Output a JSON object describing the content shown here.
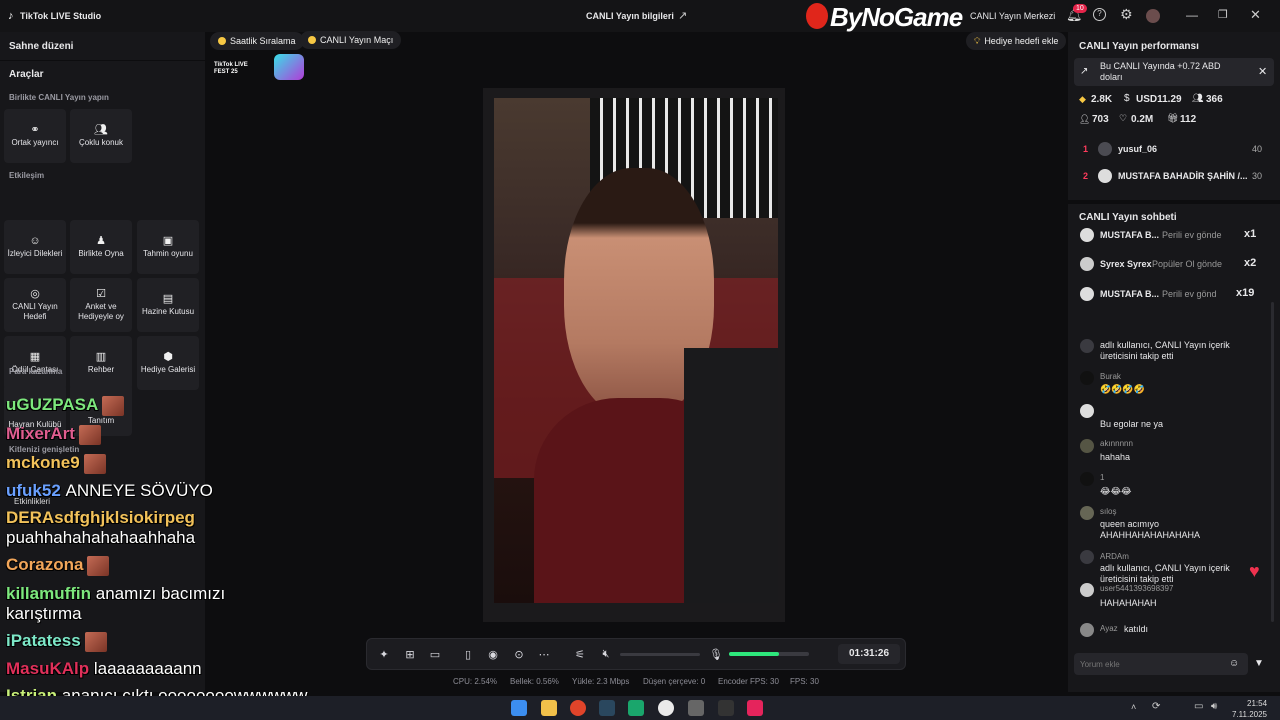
{
  "app": {
    "title": "TikTok LIVE Studio",
    "center_title": "CANLI Yayın bilgileri",
    "watermark": "ByNoGame",
    "live_center": "CANLI Yayın Merkezi",
    "notif_count": "10"
  },
  "left": {
    "scene": "Sahne düzeni",
    "tools": "Araçlar",
    "group1": "Birlikte CANLI Yayın yapın",
    "co_host": "Ortak yayıncı",
    "multi_guest": "Çoklu konuk",
    "group2": "Etkileşim",
    "viewer_wishes": "İzleyici Dilekleri",
    "play_together": "Birlikte Oyna",
    "prediction": "Tahmin oyunu",
    "live_goal": "CANLI Yayın Hedefi",
    "poll_gift": "Anket ve Hediyeyle oy",
    "treasure": "Hazine Kutusu",
    "reward_bag": "Ödül Çantası",
    "guide": "Rehber",
    "gift_gallery": "Hediye Galerisi",
    "group3": "Para kazanma",
    "fan_club": "Hayran Kulübü",
    "promotion": "Tanıtım",
    "kit": "Kitlenizi genişletin",
    "events": "Etkinlikleri"
  },
  "top_chips": {
    "hourly": "Saatlik Sıralama",
    "match": "CANLI Yayın Maçı",
    "gift_goal": "Hediye hedefi ekle",
    "fest": "TikTok LIVE FEST 25"
  },
  "overlay_chat": [
    {
      "user": "uGUZPASA",
      "msg": "",
      "color": "#7de87d",
      "emote": true
    },
    {
      "user": "MixerArt",
      "msg": "",
      "color": "#e05d8f",
      "emote": true
    },
    {
      "user": "mckone9",
      "msg": "",
      "color": "#f2c25a",
      "emote": true
    },
    {
      "user": "ufuk52",
      "msg": "ANNEYE SÖVÜYO",
      "color": "#6aa0ff",
      "emote": false
    },
    {
      "user": "DERAsdfghjklsiokirpeg",
      "msg": "",
      "color": "#f2c25a",
      "emote": false
    },
    {
      "user": "",
      "msg": "puahhahahahahaahhaha",
      "color": "#ffffff",
      "emote": false
    },
    {
      "user": "Corazona",
      "msg": "",
      "color": "#f2a65a",
      "emote": true
    },
    {
      "user": "killamuffin",
      "msg": "anamızı bacımızı",
      "color": "#7de87d",
      "emote": false
    },
    {
      "user": "",
      "msg": "karıştırma",
      "color": "#ffffff",
      "emote": false
    },
    {
      "user": "iPatatess",
      "msg": "",
      "color": "#7de8c8",
      "emote": true
    },
    {
      "user": "MasuKAlp",
      "msg": "laaaaaaaaann",
      "color": "#e0305a",
      "emote": false
    },
    {
      "user": "Istrian",
      "msg": "ananıcı çıktı oooooooowwwwww",
      "color": "#c8f07a",
      "emote": false
    }
  ],
  "controls": {
    "timer": "01:31:26",
    "mic_level": 0.62
  },
  "stats": {
    "cpu": "CPU: 2.54%",
    "memory": "Bellek: 0.56%",
    "upload": "Yükle: 2.3 Mbps",
    "dropped": "Düşen çerçeve: 0",
    "encoder_fps": "Encoder FPS: 30",
    "fps": "FPS: 30"
  },
  "right": {
    "perf_title": "CANLI Yayın performansı",
    "earn_banner": "Bu CANLI Yayında +0.72 ABD doları",
    "diamonds": "2.8K",
    "usd": "USD11.29",
    "viewers": "366",
    "followers": "703",
    "likes": "0.2M",
    "gifts": "112",
    "ranking": [
      {
        "rank": "1",
        "name": "yusuf_06",
        "score": "40"
      },
      {
        "rank": "2",
        "name": "MUSTAFA BAHADİR ŞAHİN /...",
        "score": "30"
      }
    ],
    "chat_title": "CANLI Yayın sohbeti",
    "gift_rows": [
      {
        "name": "MUSTAFA B...",
        "text": "Perili ev gönde",
        "count": "x1"
      },
      {
        "name": "Syrex Syrex",
        "text": "Popüler Ol gönde",
        "count": "x2"
      },
      {
        "name": "MUSTAFA B...",
        "text": "Perili ev gönd",
        "count": "x19"
      }
    ],
    "chat": [
      {
        "user": "",
        "text": "adlı kullanıcı, CANLI Yayın içerik üreticisini takip etti"
      },
      {
        "user": "Burak",
        "text": "🤣🤣🤣🤣"
      },
      {
        "user": "",
        "text": "Bu egolar ne ya"
      },
      {
        "user": "akınnnnn",
        "text": "hahaha"
      },
      {
        "user": "1",
        "text": "😂😂😂"
      },
      {
        "user": "sıloş",
        "text": "queen acımıyo AHAHHAHAHAHAHAHA"
      },
      {
        "user": "ARDAm",
        "text": "adlı kullanıcı, CANLI Yayın içerik üreticisini takip etti"
      },
      {
        "user": "user5441393698397",
        "text": "HAHAHAHAH"
      },
      {
        "user": "Ayaz",
        "text": "katıldı"
      }
    ],
    "comment_placeholder": "Yorum ekle"
  },
  "taskbar": {
    "time": "21:54",
    "date": "7.11.2025"
  }
}
